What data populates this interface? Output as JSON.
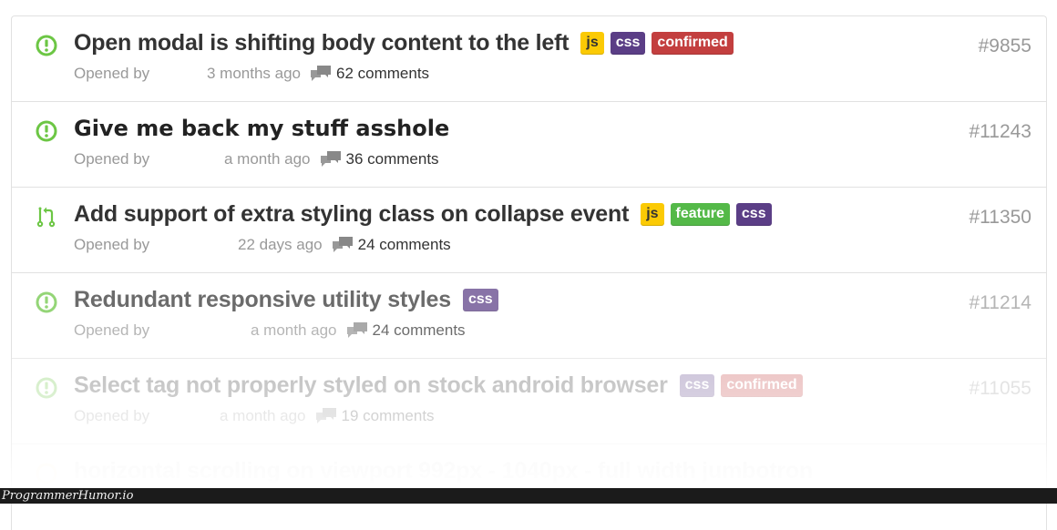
{
  "colors": {
    "open_icon": "#6cc644",
    "label_js": "#fbca04",
    "label_css": "#5b3e86",
    "label_confirmed": "#c33f3f",
    "label_feature": "#54b948",
    "muted_text": "#999999",
    "title_text": "#333333"
  },
  "issues": [
    {
      "icon": "issue-opened-icon",
      "title": "Open modal is shifting body content to the left",
      "labels": [
        {
          "name": "js",
          "color": "#fbca04"
        },
        {
          "name": "css",
          "color": "#5b3e86"
        },
        {
          "name": "confirmed",
          "color": "#c33f3f"
        }
      ],
      "opened_by": "Opened by",
      "time_ago": "3 months ago",
      "comments": "62 comments",
      "number": "#9855"
    },
    {
      "icon": "issue-opened-icon",
      "title": "Give me back my stuff asshole",
      "labels": [],
      "opened_by": "Opened by",
      "time_ago": "a month ago",
      "comments": "36 comments",
      "number": "#11243"
    },
    {
      "icon": "pull-request-icon",
      "title": "Add support of extra styling class on collapse event",
      "labels": [
        {
          "name": "js",
          "color": "#fbca04"
        },
        {
          "name": "feature",
          "color": "#54b948"
        },
        {
          "name": "css",
          "color": "#5b3e86"
        }
      ],
      "opened_by": "Opened by",
      "time_ago": "22 days ago",
      "comments": "24 comments",
      "number": "#11350"
    },
    {
      "icon": "issue-opened-icon",
      "title": "Redundant responsive utility styles",
      "labels": [
        {
          "name": "css",
          "color": "#5b3e86"
        }
      ],
      "opened_by": "Opened by",
      "time_ago": "a month ago",
      "comments": "24 comments",
      "number": "#11214"
    },
    {
      "icon": "issue-opened-icon",
      "title": "Select tag not properly styled on stock android browser",
      "labels": [
        {
          "name": "css",
          "color": "#5b3e86"
        },
        {
          "name": "confirmed",
          "color": "#c33f3f"
        }
      ],
      "opened_by": "Opened by",
      "time_ago": "a month ago",
      "comments": "19 comments",
      "number": "#11055"
    },
    {
      "icon": "issue-opened-icon",
      "title": "horizontal scrolling on viewport 992px - 1040px - full width jumbotron",
      "labels": [],
      "opened_by": "",
      "time_ago": "",
      "comments": "",
      "number": ""
    }
  ],
  "watermark": "ProgrammerHumor.io"
}
